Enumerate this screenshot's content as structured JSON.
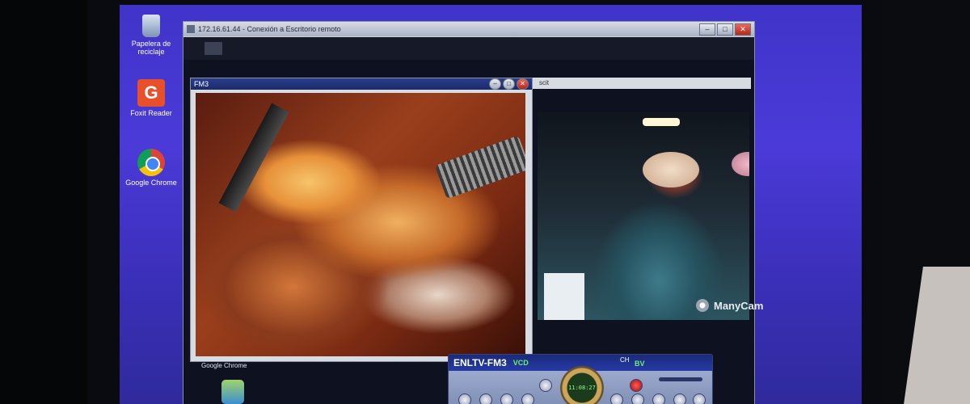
{
  "desktop": {
    "icons": [
      {
        "label": "Papelera de reciclaje"
      },
      {
        "label": "Foxit Reader"
      },
      {
        "label": "Google Chrome"
      }
    ]
  },
  "remote_window": {
    "title": "172.16.61.44 - Conexión a Escritorio remoto",
    "controls": {
      "minimize": "–",
      "maximize": "□",
      "close": "✕"
    }
  },
  "lap_window": {
    "title": "FM3",
    "footer": "Google Chrome"
  },
  "or_window": {
    "title": "scit",
    "overlay": "ManyCam"
  },
  "player": {
    "title": "ENLTV-FM3",
    "mode": "VCD",
    "ch_label": "CH",
    "source": "BV",
    "time": "11:08:27"
  },
  "colors": {
    "desktop_bg": "#4b3ad8",
    "title_bar": "#1c2a66",
    "player_bar": "#253aa8",
    "accent_green": "#6cf26c"
  },
  "icons": [
    "recycle-bin-icon",
    "foxit-icon",
    "chrome-icon",
    "manycam-icon",
    "record-icon"
  ]
}
